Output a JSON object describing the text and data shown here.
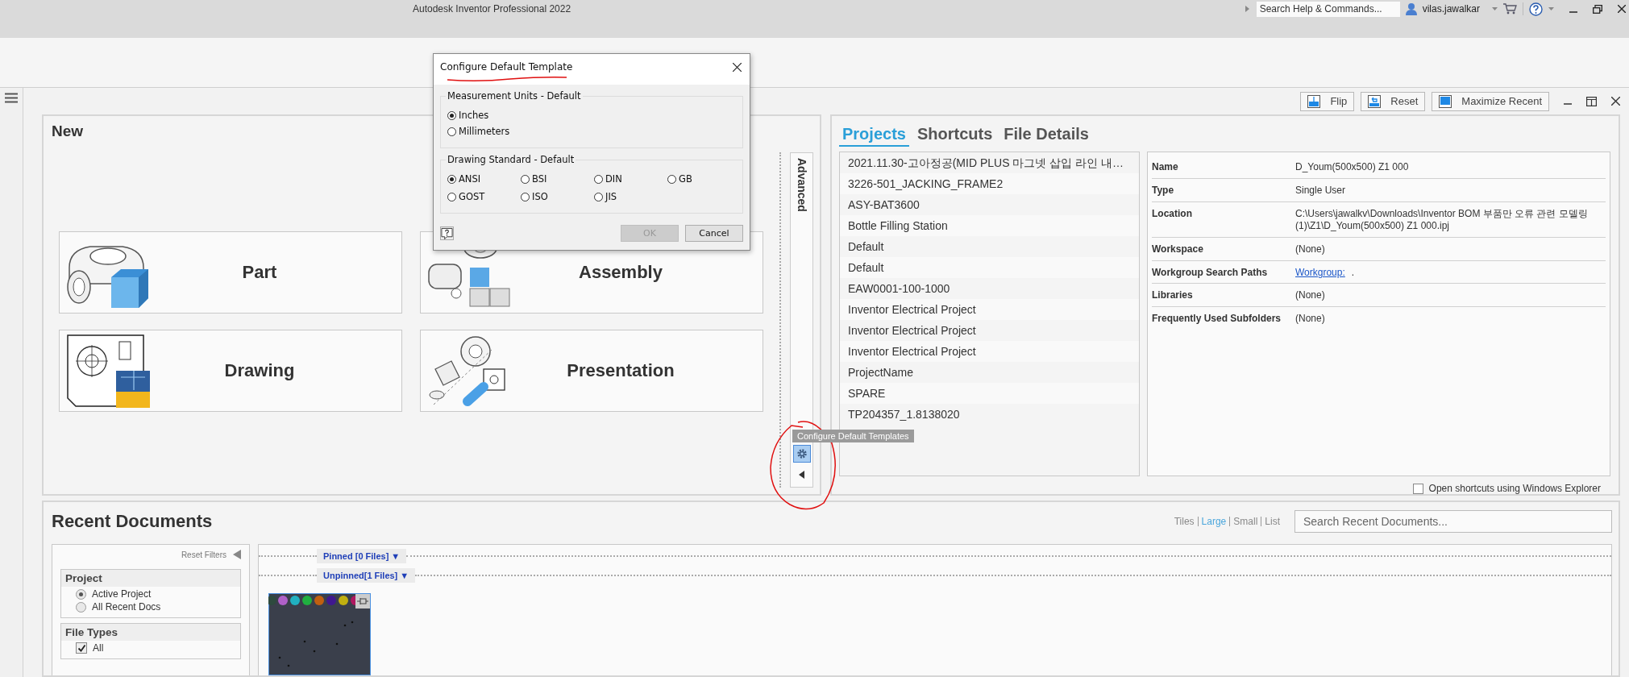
{
  "title_bar": {
    "title": "Autodesk Inventor Professional 2022",
    "search_placeholder": "Search Help & Commands...",
    "user": "vilas.jawalkar"
  },
  "toolbar": {
    "buttons": [
      {
        "label": "Flip",
        "kind": "flip"
      },
      {
        "label": "Reset",
        "kind": "reset"
      },
      {
        "label": "Maximize Recent",
        "kind": "maximize"
      }
    ]
  },
  "new_panel": {
    "title": "New",
    "advanced_label": "Advanced",
    "tooltip": "Configure Default Templates",
    "tiles": [
      {
        "label": "Part",
        "kind": "part"
      },
      {
        "label": "Assembly",
        "kind": "assembly"
      },
      {
        "label": "Drawing",
        "kind": "drawing"
      },
      {
        "label": "Presentation",
        "kind": "presentation"
      }
    ]
  },
  "projects_panel": {
    "tabs": [
      {
        "label": "Projects",
        "selected": true
      },
      {
        "label": "Shortcuts",
        "selected": false
      },
      {
        "label": "File Details",
        "selected": false
      }
    ],
    "projects": [
      "2021.11.30-고아정공(MID PLUS 마그넷 삽입 라인 내…",
      "3226-501_JACKING_FRAME2",
      "ASY-BAT3600",
      "Bottle Filling Station",
      "Default",
      "Default",
      "EAW0001-100-1000",
      "Inventor Electrical Project",
      "Inventor Electrical Project",
      "Inventor Electrical Project",
      "ProjectName",
      "SPARE",
      "TP204357_1.8138020"
    ],
    "details": [
      {
        "label": "Name",
        "value": "D_Youm(500x500) Z1 000"
      },
      {
        "label": "Type",
        "value": "Single User"
      },
      {
        "label": "Location",
        "value": "C:\\Users\\jawalkv\\Downloads\\Inventor BOM 부품만 오류 관련 모델링 (1)\\Z1\\D_Youm(500x500) Z1 000.ipj"
      },
      {
        "label": "Workspace",
        "value": "(None)"
      },
      {
        "label": "Workgroup Search Paths",
        "link": "Workgroup:",
        "value": "."
      },
      {
        "label": "Libraries",
        "value": "(None)"
      },
      {
        "label": "Frequently Used Subfolders",
        "value": "(None)"
      }
    ],
    "explorer_option": {
      "label": "Open shortcuts using Windows Explorer",
      "checked": false
    }
  },
  "recent": {
    "title": "Recent Documents",
    "views": [
      {
        "label": "Tiles",
        "selected": false
      },
      {
        "label": "Large",
        "selected": true
      },
      {
        "label": "Small",
        "selected": false
      },
      {
        "label": "List",
        "selected": false
      }
    ],
    "search_placeholder": "Search Recent Documents...",
    "reset_filters": "Reset Filters",
    "project_filter": {
      "title": "Project",
      "options": [
        {
          "label": "Active Project",
          "selected": true
        },
        {
          "label": "All Recent Docs",
          "selected": false
        }
      ]
    },
    "file_types": {
      "title": "File Types",
      "options": [
        {
          "label": "All",
          "checked": true
        }
      ]
    },
    "groups": [
      "Pinned [0 Files] ▼",
      "Unpinned[1 Files] ▼"
    ],
    "files": [
      {
        "kind": "picture"
      }
    ]
  },
  "dialog": {
    "title": "Configure Default Template",
    "units": {
      "title": "Measurement Units - Default",
      "options": [
        {
          "label": "Inches",
          "selected": true
        },
        {
          "label": "Millimeters",
          "selected": false
        }
      ]
    },
    "standards": {
      "title": "Drawing Standard - Default",
      "options": [
        {
          "label": "ANSI",
          "selected": true
        },
        {
          "label": "BSI",
          "selected": false
        },
        {
          "label": "DIN",
          "selected": false
        },
        {
          "label": "GB",
          "selected": false
        },
        {
          "label": "GOST",
          "selected": false
        },
        {
          "label": "ISO",
          "selected": false
        },
        {
          "label": "JIS",
          "selected": false
        }
      ]
    },
    "buttons": [
      {
        "label": "OK",
        "disabled": true
      },
      {
        "label": "Cancel",
        "disabled": false
      }
    ]
  }
}
